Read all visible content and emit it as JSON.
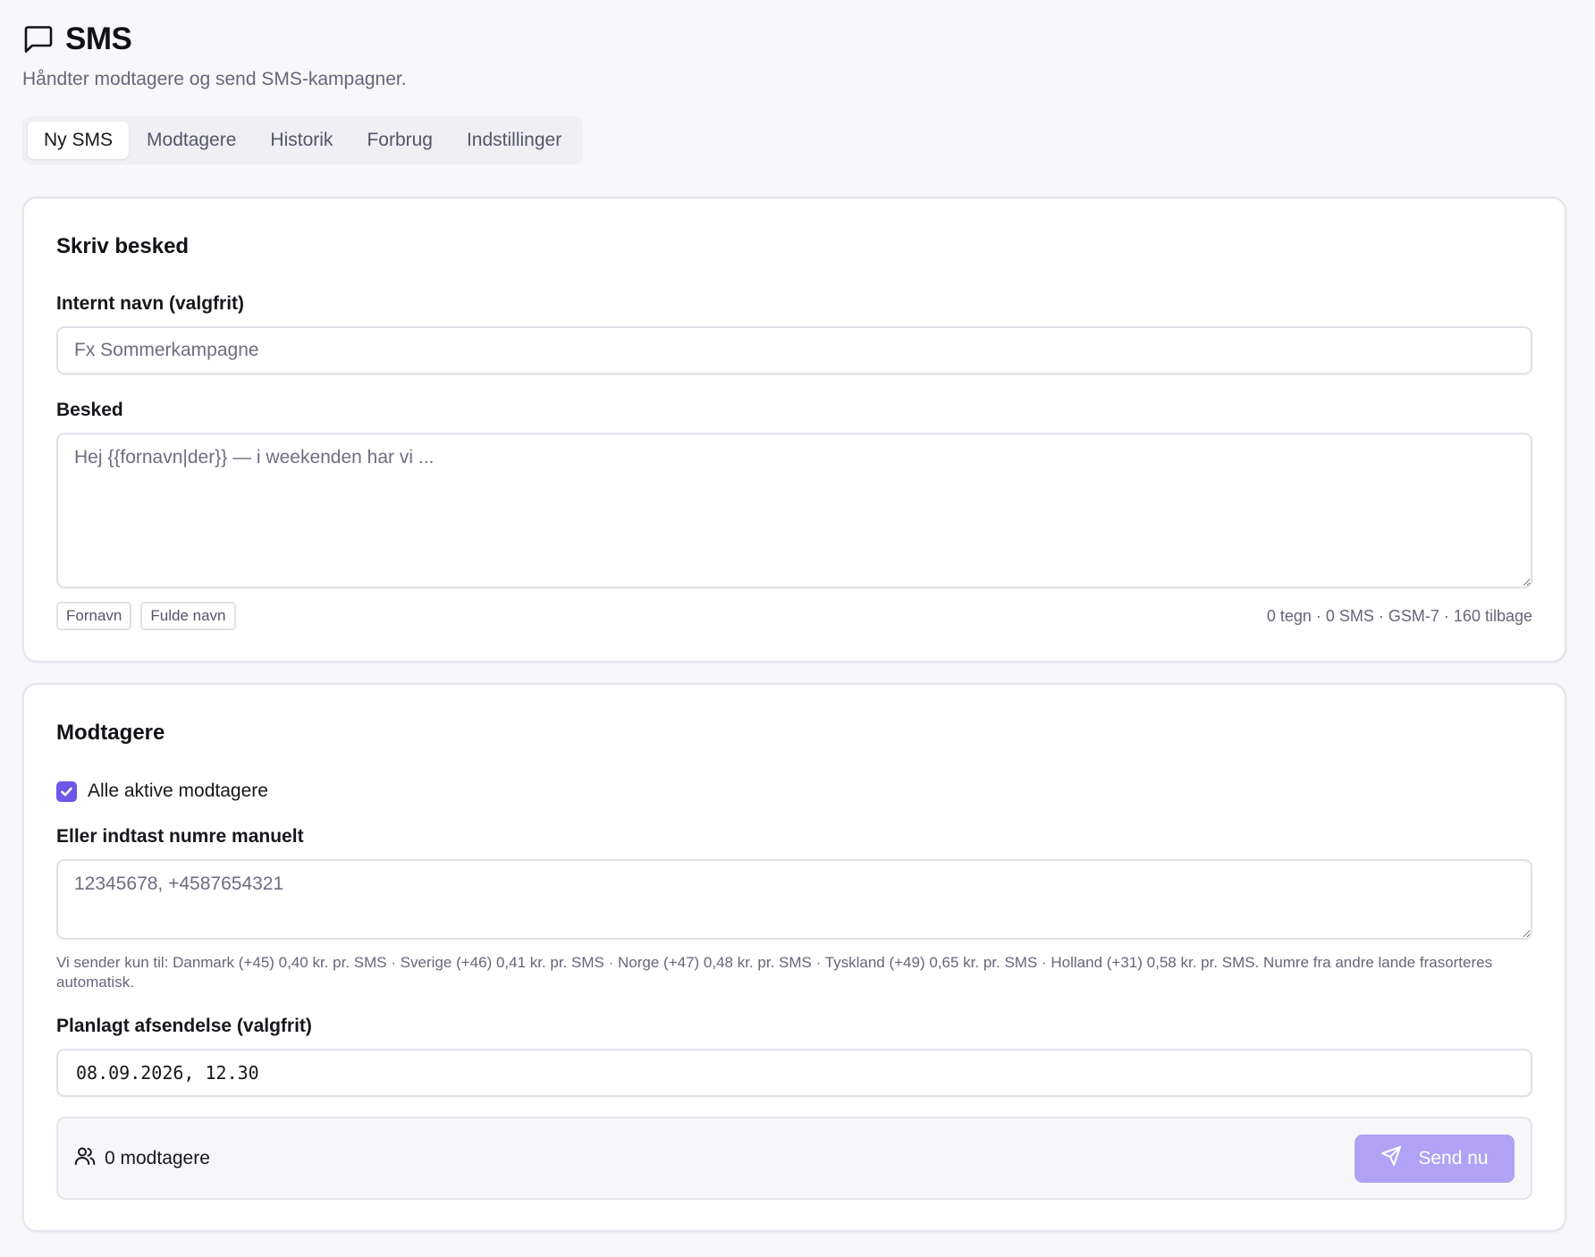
{
  "header": {
    "icon": "message-square-icon",
    "title": "SMS",
    "subtitle": "Håndter modtagere og send SMS-kampagner."
  },
  "tabs": [
    {
      "label": "Ny SMS",
      "active": true
    },
    {
      "label": "Modtagere",
      "active": false
    },
    {
      "label": "Historik",
      "active": false
    },
    {
      "label": "Forbrug",
      "active": false
    },
    {
      "label": "Indstillinger",
      "active": false
    }
  ],
  "compose": {
    "title": "Skriv besked",
    "name_label": "Internt navn (valgfrit)",
    "name_placeholder": "Fx Sommerkampagne",
    "name_value": "",
    "message_label": "Besked",
    "message_placeholder": "Hej {{fornavn|der}} — i weekenden har vi ...",
    "message_value": "",
    "chips": [
      "Fornavn",
      "Fulde navn"
    ],
    "counter": "0 tegn · 0 SMS · GSM-7 · 160 tilbage"
  },
  "recipients": {
    "title": "Modtagere",
    "all_active_label": "Alle aktive modtagere",
    "all_active_checked": true,
    "manual_label": "Eller indtast numre manuelt",
    "manual_placeholder": "12345678, +4587654321",
    "manual_value": "",
    "hint": "Vi sender kun til: Danmark (+45) 0,40 kr. pr. SMS · Sverige (+46) 0,41 kr. pr. SMS · Norge (+47) 0,48 kr. pr. SMS · Tyskland (+49) 0,65 kr. pr. SMS · Holland (+31) 0,58 kr. pr. SMS. Numre fra andre lande frasorteres automatisk.",
    "schedule_label": "Planlagt afsendelse (valgfrit)",
    "schedule_value": "08.09.2026, 12.30",
    "recipient_count": "0 modtagere",
    "send_label": "Send nu"
  },
  "colors": {
    "accent": "#6f55e8",
    "send_disabled": "#b1a2f5",
    "background": "#f8f8fb"
  }
}
